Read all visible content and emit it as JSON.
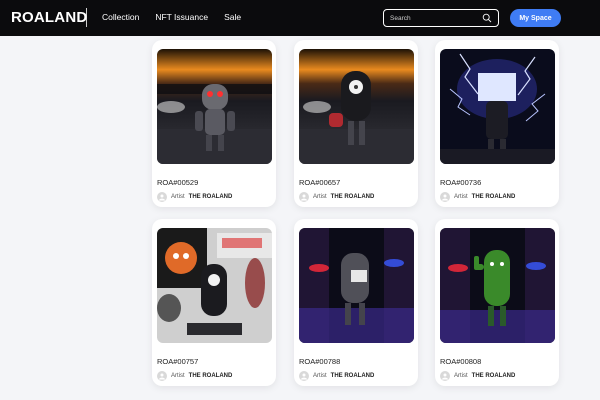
{
  "header": {
    "logo": "ROALAND",
    "nav": [
      "Collection",
      "NFT Issuance",
      "Sale"
    ],
    "search_placeholder": "Search",
    "my_space_label": "My Space"
  },
  "cards": [
    {
      "id": "ROA#00529",
      "artist_label": "Artist",
      "artist_name": "THE ROALAND",
      "scene": "city-night-robot"
    },
    {
      "id": "ROA#00657",
      "artist_label": "Artist",
      "artist_name": "THE ROALAND",
      "scene": "city-night-robot-red"
    },
    {
      "id": "ROA#00736",
      "artist_label": "Artist",
      "artist_name": "THE ROALAND",
      "scene": "lightning-robot"
    },
    {
      "id": "ROA#00757",
      "artist_label": "Artist",
      "artist_name": "THE ROALAND",
      "scene": "art-wall-robot"
    },
    {
      "id": "ROA#00788",
      "artist_label": "Artist",
      "artist_name": "THE ROALAND",
      "scene": "neon-club-robot"
    },
    {
      "id": "ROA#00808",
      "artist_label": "Artist",
      "artist_name": "THE ROALAND",
      "scene": "green-cactus-robot"
    }
  ],
  "colors": {
    "header_bg": "#0b0b0d",
    "accent": "#3f7cf4",
    "page_bg": "#f4f5f8"
  }
}
